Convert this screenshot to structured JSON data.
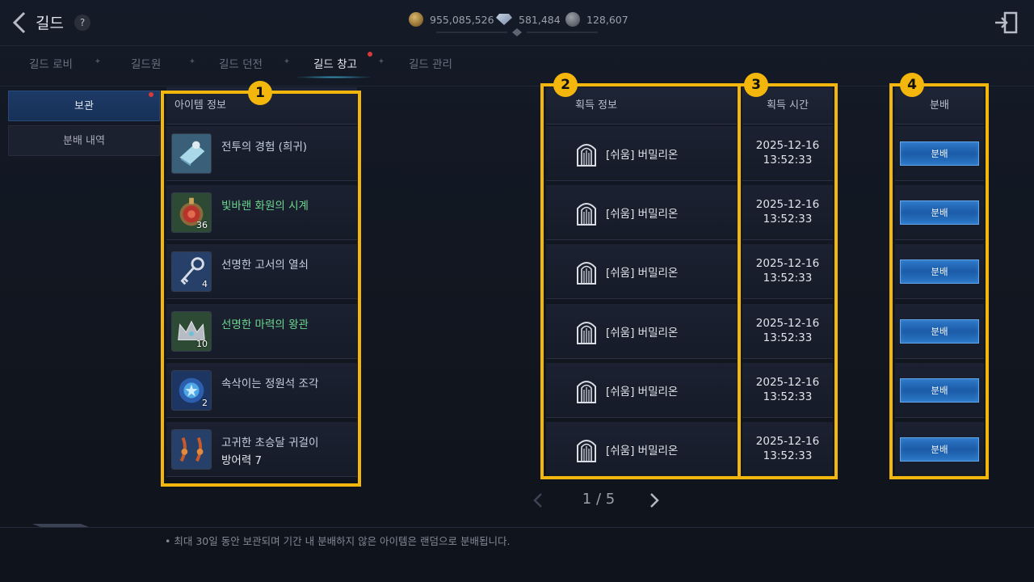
{
  "header": {
    "title": "길드",
    "help_label": "?",
    "currencies": [
      {
        "icon": "gold-coin-icon",
        "value": "955,085,526"
      },
      {
        "icon": "diamond-icon",
        "value": "581,484"
      },
      {
        "icon": "token-icon",
        "value": "128,607"
      }
    ]
  },
  "tabs": [
    {
      "label": "길드 로비",
      "active": false
    },
    {
      "label": "길드원",
      "active": false
    },
    {
      "label": "길드 던전",
      "active": false
    },
    {
      "label": "길드 창고",
      "active": true
    },
    {
      "label": "길드 관리",
      "active": false
    }
  ],
  "sidebar": {
    "items": [
      {
        "label": "보관",
        "active": true
      },
      {
        "label": "분배 내역",
        "active": false
      }
    ]
  },
  "table": {
    "headers": {
      "item": "아이템 정보",
      "acquire": "획득 정보",
      "time": "획득 시간",
      "distribute": "분배"
    },
    "rows": [
      {
        "icon": "scroll-icon",
        "name": "전투의 경험 (희귀)",
        "rarity": "blue",
        "count": "",
        "sub": "",
        "acquire": "[쉬움] 버밀리온",
        "date": "2025-12-16",
        "time": "13:52:33",
        "button": "분배"
      },
      {
        "icon": "pocket-watch-icon",
        "name": "빛바랜 화원의 시계",
        "rarity": "green",
        "count": "36",
        "sub": "",
        "acquire": "[쉬움] 버밀리온",
        "date": "2025-12-16",
        "time": "13:52:33",
        "button": "분배"
      },
      {
        "icon": "key-icon",
        "name": "선명한 고서의 열쇠",
        "rarity": "blue",
        "count": "4",
        "sub": "",
        "acquire": "[쉬움] 버밀리온",
        "date": "2025-12-16",
        "time": "13:52:33",
        "button": "분배"
      },
      {
        "icon": "crown-icon",
        "name": "선명한 마력의 왕관",
        "rarity": "green",
        "count": "10",
        "sub": "",
        "acquire": "[쉬움] 버밀리온",
        "date": "2025-12-16",
        "time": "13:52:33",
        "button": "분배"
      },
      {
        "icon": "spirit-stone-icon",
        "name": "속삭이는 정원석 조각",
        "rarity": "blue",
        "count": "2",
        "sub": "",
        "acquire": "[쉬움] 버밀리온",
        "date": "2025-12-16",
        "time": "13:52:33",
        "button": "분배"
      },
      {
        "icon": "earring-icon",
        "name": "고귀한 초승달 귀걸이",
        "rarity": "blue",
        "count": "",
        "sub": "방어력  7",
        "acquire": "[쉬움] 버밀리온",
        "date": "2025-12-16",
        "time": "13:52:33",
        "button": "분배"
      }
    ]
  },
  "annotations": [
    "1",
    "2",
    "3",
    "4"
  ],
  "pagination": {
    "text": "1 / 5"
  },
  "notice": "•  최대 30일 동안 보관되며 기간 내 분배하지 않은 아이템은 랜덤으로 분배됩니다.",
  "colors": {
    "annotation": "#f3b60c",
    "green_item": "#6cd88e",
    "button": "#2e78c8"
  }
}
